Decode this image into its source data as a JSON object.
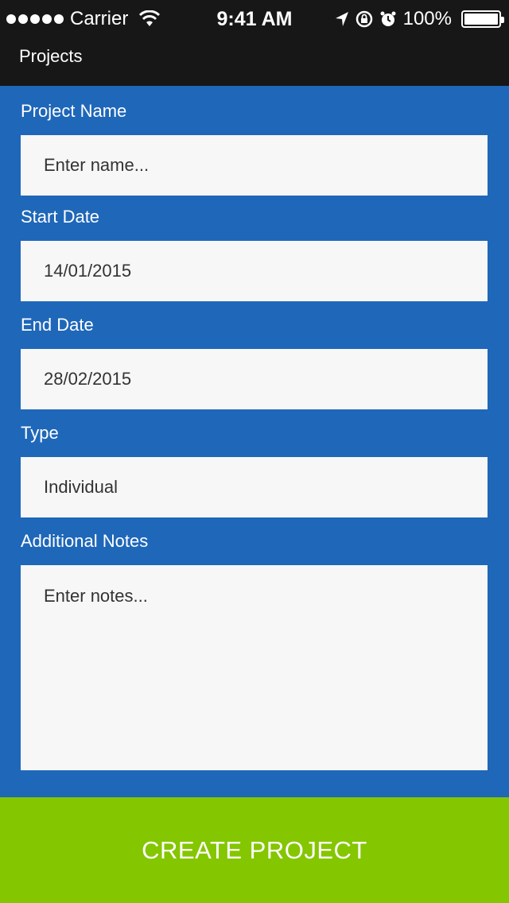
{
  "status_bar": {
    "carrier": "Carrier",
    "time": "9:41 AM",
    "battery": "100%",
    "icons": [
      "signal-dots-icon",
      "wifi-icon",
      "location-arrow-icon",
      "rotation-lock-icon",
      "alarm-icon",
      "battery-icon"
    ]
  },
  "nav": {
    "title": "Projects"
  },
  "form": {
    "project_name": {
      "label": "Project Name",
      "placeholder": "Enter name..."
    },
    "start_date": {
      "label": "Start Date",
      "value": "14/01/2015"
    },
    "end_date": {
      "label": "End Date",
      "value": "28/02/2015"
    },
    "type": {
      "label": "Type",
      "value": "Individual"
    },
    "notes": {
      "label": "Additional Notes",
      "placeholder": "Enter notes..."
    }
  },
  "actions": {
    "create_label": "CREATE PROJECT"
  },
  "colors": {
    "background": "#1f67b9",
    "bar": "#171717",
    "field": "#f7f7f7",
    "button": "#84c600"
  }
}
